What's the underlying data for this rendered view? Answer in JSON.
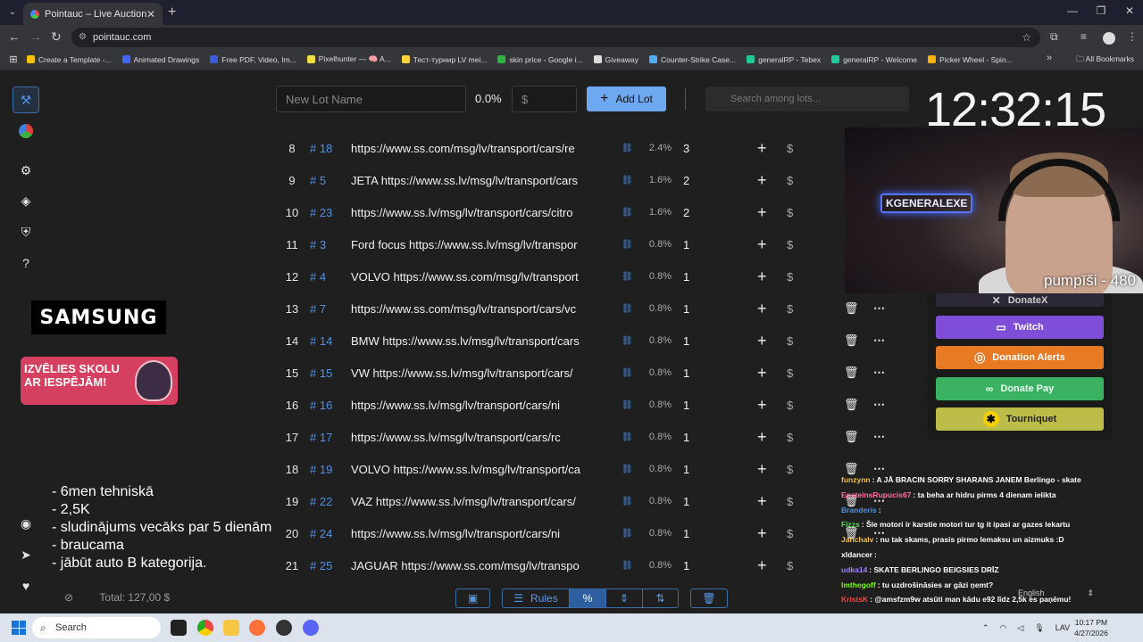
{
  "browser": {
    "tab_title": "Pointauc – Live Auctions, Lotter",
    "url": "pointauc.com",
    "bookmarks": [
      {
        "label": "Create a Template -...",
        "color": "#f5c000"
      },
      {
        "label": "Animated Drawings",
        "color": "#4466ff"
      },
      {
        "label": "Free PDF, Video, Im...",
        "color": "#3b5bdb"
      },
      {
        "label": "Pixelhunter — 🧠 A...",
        "color": "#f0e040"
      },
      {
        "label": "Тест-турнир LV mei...",
        "color": "#ffd43b"
      },
      {
        "label": "skin price - Google i...",
        "color": "#2fb344"
      },
      {
        "label": "Giveaway",
        "color": "#dddddd"
      },
      {
        "label": "Counter-Strike Case...",
        "color": "#4dabf7"
      },
      {
        "label": "generalRP - Tebex",
        "color": "#20c997"
      },
      {
        "label": "generalRP - Welcome",
        "color": "#20c997"
      },
      {
        "label": "Picker Wheel - Spin...",
        "color": "#fab005"
      }
    ],
    "all_bookmarks": "All Bookmarks"
  },
  "controls": {
    "lot_name_placeholder": "New Lot Name",
    "percent": "0.0%",
    "amount_placeholder": "$",
    "add_lot": "Add Lot",
    "search_placeholder": "Search among lots..."
  },
  "clock": "12:32:15",
  "lots": [
    {
      "num": "8",
      "tag": "# 18",
      "name": "https://www.ss.com/msg/lv/transport/cars/re",
      "percent": "2.4%",
      "amount": "3",
      "actions": false
    },
    {
      "num": "9",
      "tag": "# 5",
      "name": "JETA https://www.ss.lv/msg/lv/transport/cars",
      "percent": "1.6%",
      "amount": "2",
      "actions": false
    },
    {
      "num": "10",
      "tag": "# 23",
      "name": "https://www.ss.lv/msg/lv/transport/cars/citro",
      "percent": "1.6%",
      "amount": "2",
      "actions": false
    },
    {
      "num": "11",
      "tag": "# 3",
      "name": "Ford focus https://www.ss.lv/msg/lv/transpor",
      "percent": "0.8%",
      "amount": "1",
      "actions": false
    },
    {
      "num": "12",
      "tag": "# 4",
      "name": "VOLVO https://www.ss.com/msg/lv/transport",
      "percent": "0.8%",
      "amount": "1",
      "actions": false
    },
    {
      "num": "13",
      "tag": "# 7",
      "name": "https://www.ss.com/msg/lv/transport/cars/vc",
      "percent": "0.8%",
      "amount": "1",
      "actions": true
    },
    {
      "num": "14",
      "tag": "# 14",
      "name": "BMW https://www.ss.lv/msg/lv/transport/cars",
      "percent": "0.8%",
      "amount": "1",
      "actions": true
    },
    {
      "num": "15",
      "tag": "# 15",
      "name": "VW https://www.ss.lv/msg/lv/transport/cars/",
      "percent": "0.8%",
      "amount": "1",
      "actions": true
    },
    {
      "num": "16",
      "tag": "# 16",
      "name": "https://www.ss.lv/msg/lv/transport/cars/ni",
      "percent": "0.8%",
      "amount": "1",
      "actions": true
    },
    {
      "num": "17",
      "tag": "# 17",
      "name": "https://www.ss.lv/msg/lv/transport/cars/rc",
      "percent": "0.8%",
      "amount": "1",
      "actions": true
    },
    {
      "num": "18",
      "tag": "# 19",
      "name": "VOLVO https://www.ss.lv/msg/lv/transport/ca",
      "percent": "0.8%",
      "amount": "1",
      "actions": true
    },
    {
      "num": "19",
      "tag": "# 22",
      "name": "VAZ https://www.ss.lv/msg/lv/transport/cars/",
      "percent": "0.8%",
      "amount": "1",
      "actions": true
    },
    {
      "num": "20",
      "tag": "# 24",
      "name": "https://www.ss.lv/msg/lv/transport/cars/ni",
      "percent": "0.8%",
      "amount": "1",
      "actions": true
    },
    {
      "num": "21",
      "tag": "# 25",
      "name": "JAGUAR https://www.ss.com/msg/lv/transpo",
      "percent": "0.8%",
      "amount": "1",
      "actions": false
    }
  ],
  "sidebar": {
    "samsung": "SAMSUNG",
    "promo": "IZVĒLIES SKOLU AR IESPĒJĀM!",
    "notes": [
      "- 6men tehniskā",
      "- 2,5K",
      "- sludinājums vecāks par 5 dienām",
      "- braucama",
      "- jābūt auto B kategorija."
    ],
    "total_label": "Total: 127,00 $"
  },
  "webcam": {
    "neon_sign": "KGENERALEXE",
    "overlay": "pumpīši - 480"
  },
  "donations": {
    "donatex": "DonateX",
    "twitch": "Twitch",
    "alerts": "Donation Alerts",
    "pay": "Donate Pay",
    "tourniquet": "Tourniquet"
  },
  "chat": [
    {
      "user": "funzynn",
      "color": "#f0c040",
      "text": "A JĀ BRACIN SORRY SHARANS JANEM Berlingo - skate"
    },
    {
      "user": "EpsteinsRupucis67",
      "color": "#ff6fa0",
      "text": "ta beha ar hidru pirms 4 dienam ielikta"
    },
    {
      "user": "Branderis",
      "color": "#4e92e6",
      "text": ""
    },
    {
      "user": "Fizzs",
      "color": "#5cd65c",
      "text": "Šie motori ir karstie motori tur tg it ipasi ar gazes lekartu"
    },
    {
      "user": "Janchalv",
      "color": "#f0c040",
      "text": "nu tak skams, prasis pirmo lemaksu un aizmuks :D"
    },
    {
      "user": "xldancer",
      "color": "#ffffff",
      "text": ""
    },
    {
      "user": "udka14",
      "color": "#a080ff",
      "text": "SKATE BERLINGO BEIGSIES DRĪZ"
    },
    {
      "user": "lmthegoff",
      "color": "#7cfc00",
      "text": "tu uzdrošināsies ar gāzi ņemt?"
    },
    {
      "user": "KristsK",
      "color": "#ff4040",
      "text": "@amsfzm9w atsūti man kādu e92 līdz 2,5k es paņēmu!"
    }
  ],
  "chat_language": "English",
  "toolbar": {
    "rules": "Rules"
  },
  "taskbar": {
    "search": "Search",
    "lang": "LAV",
    "time": "10:17 PM",
    "date": "4/27/2026"
  }
}
